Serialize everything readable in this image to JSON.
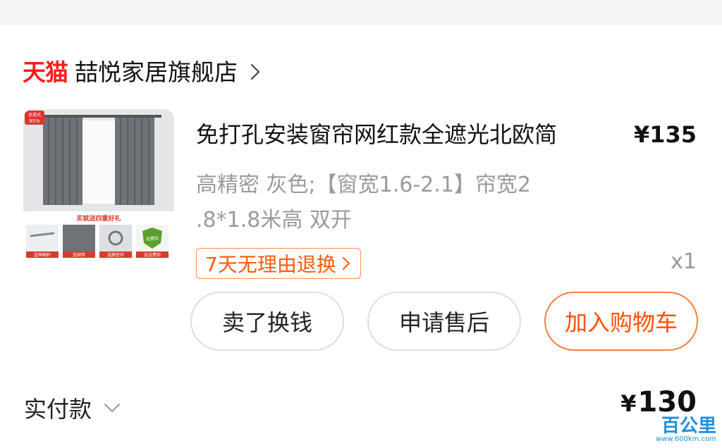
{
  "shop": {
    "platform_label": "天猫",
    "name": "喆悦家居旗舰店"
  },
  "product": {
    "title": "免打孔安装窗帘网红款全遮光北欧简",
    "price": "¥135",
    "spec_line1": "高精密 灰色;【窗宽1.6-2.1】帘宽2",
    "spec_line2": ".8*1.8米高 双开",
    "return_badge": "7天无理由退换",
    "quantity": "x1",
    "thumbnail": {
      "top_badge_line1": "总遮光",
      "top_badge_line2": "95%",
      "promo_text": "买就送四重好礼",
      "gift_labels": [
        "送伸缩杆",
        "送绑带",
        "送静音环",
        "送运费险"
      ],
      "shield_text": "运费险"
    }
  },
  "actions": {
    "sell_label": "卖了换钱",
    "after_sale_label": "申请售后",
    "add_cart_label": "加入购物车"
  },
  "payment": {
    "label": "实付款",
    "currency": "¥",
    "amount": "130"
  },
  "watermark": {
    "main": "百公里",
    "sub": "www.600km.com"
  },
  "colors": {
    "brand_red": "#ff1b1b",
    "accent_orange": "#ff5000",
    "muted_gray": "#9a9a9a"
  }
}
